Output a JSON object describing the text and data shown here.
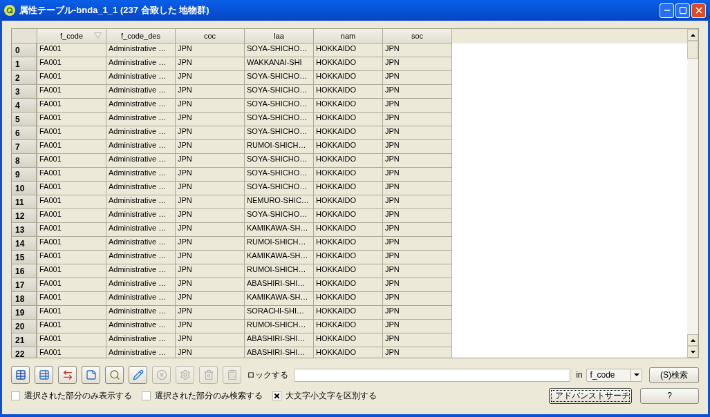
{
  "window": {
    "title": "属性テーブル-bnda_1_1 (237 合致した 地物群)"
  },
  "table": {
    "columns": [
      {
        "label": "f_code",
        "sorted": true
      },
      {
        "label": "f_code_des",
        "sorted": false
      },
      {
        "label": "coc",
        "sorted": false
      },
      {
        "label": "laa",
        "sorted": false
      },
      {
        "label": "nam",
        "sorted": false
      },
      {
        "label": "soc",
        "sorted": false
      }
    ],
    "rows": [
      {
        "header": "0",
        "cells": [
          "FA001",
          "Administrative …",
          "JPN",
          "SOYA-SHICHO…",
          "HOKKAIDO",
          "JPN"
        ]
      },
      {
        "header": "1",
        "cells": [
          "FA001",
          "Administrative …",
          "JPN",
          "WAKKANAI-SHI",
          "HOKKAIDO",
          "JPN"
        ]
      },
      {
        "header": "2",
        "cells": [
          "FA001",
          "Administrative …",
          "JPN",
          "SOYA-SHICHO…",
          "HOKKAIDO",
          "JPN"
        ]
      },
      {
        "header": "3",
        "cells": [
          "FA001",
          "Administrative …",
          "JPN",
          "SOYA-SHICHO…",
          "HOKKAIDO",
          "JPN"
        ]
      },
      {
        "header": "4",
        "cells": [
          "FA001",
          "Administrative …",
          "JPN",
          "SOYA-SHICHO…",
          "HOKKAIDO",
          "JPN"
        ]
      },
      {
        "header": "5",
        "cells": [
          "FA001",
          "Administrative …",
          "JPN",
          "SOYA-SHICHO…",
          "HOKKAIDO",
          "JPN"
        ]
      },
      {
        "header": "6",
        "cells": [
          "FA001",
          "Administrative …",
          "JPN",
          "SOYA-SHICHO…",
          "HOKKAIDO",
          "JPN"
        ]
      },
      {
        "header": "7",
        "cells": [
          "FA001",
          "Administrative …",
          "JPN",
          "RUMOI-SHICH…",
          "HOKKAIDO",
          "JPN"
        ]
      },
      {
        "header": "8",
        "cells": [
          "FA001",
          "Administrative …",
          "JPN",
          "SOYA-SHICHO…",
          "HOKKAIDO",
          "JPN"
        ]
      },
      {
        "header": "9",
        "cells": [
          "FA001",
          "Administrative …",
          "JPN",
          "SOYA-SHICHO…",
          "HOKKAIDO",
          "JPN"
        ]
      },
      {
        "header": "10",
        "cells": [
          "FA001",
          "Administrative …",
          "JPN",
          "SOYA-SHICHO…",
          "HOKKAIDO",
          "JPN"
        ]
      },
      {
        "header": "11",
        "cells": [
          "FA001",
          "Administrative …",
          "JPN",
          "NEMURO-SHIC…",
          "HOKKAIDO",
          "JPN"
        ]
      },
      {
        "header": "12",
        "cells": [
          "FA001",
          "Administrative …",
          "JPN",
          "SOYA-SHICHO…",
          "HOKKAIDO",
          "JPN"
        ]
      },
      {
        "header": "13",
        "cells": [
          "FA001",
          "Administrative …",
          "JPN",
          "KAMIKAWA-SH…",
          "HOKKAIDO",
          "JPN"
        ]
      },
      {
        "header": "14",
        "cells": [
          "FA001",
          "Administrative …",
          "JPN",
          "RUMOI-SHICH…",
          "HOKKAIDO",
          "JPN"
        ]
      },
      {
        "header": "15",
        "cells": [
          "FA001",
          "Administrative …",
          "JPN",
          "KAMIKAWA-SH…",
          "HOKKAIDO",
          "JPN"
        ]
      },
      {
        "header": "16",
        "cells": [
          "FA001",
          "Administrative …",
          "JPN",
          "RUMOI-SHICH…",
          "HOKKAIDO",
          "JPN"
        ]
      },
      {
        "header": "17",
        "cells": [
          "FA001",
          "Administrative …",
          "JPN",
          "ABASHIRI-SHI…",
          "HOKKAIDO",
          "JPN"
        ]
      },
      {
        "header": "18",
        "cells": [
          "FA001",
          "Administrative …",
          "JPN",
          "KAMIKAWA-SH…",
          "HOKKAIDO",
          "JPN"
        ]
      },
      {
        "header": "19",
        "cells": [
          "FA001",
          "Administrative …",
          "JPN",
          "SORACHI-SHI…",
          "HOKKAIDO",
          "JPN"
        ]
      },
      {
        "header": "20",
        "cells": [
          "FA001",
          "Administrative …",
          "JPN",
          "RUMOI-SHICH…",
          "HOKKAIDO",
          "JPN"
        ]
      },
      {
        "header": "21",
        "cells": [
          "FA001",
          "Administrative …",
          "JPN",
          "ABASHIRI-SHI…",
          "HOKKAIDO",
          "JPN"
        ]
      },
      {
        "header": "22",
        "cells": [
          "FA001",
          "Administrative …",
          "JPN",
          "ABASHIRI-SHI…",
          "HOKKAIDO",
          "JPN"
        ]
      }
    ]
  },
  "toolbar": [
    {
      "kind": "table",
      "disabled": false
    },
    {
      "kind": "table-up",
      "disabled": false
    },
    {
      "kind": "table-swap",
      "disabled": false
    },
    {
      "kind": "table-note",
      "disabled": false
    },
    {
      "kind": "zoom",
      "disabled": false
    },
    {
      "kind": "edit",
      "disabled": false
    },
    {
      "kind": "remove",
      "disabled": true
    },
    {
      "kind": "table-settings",
      "disabled": true
    },
    {
      "kind": "table-delete",
      "disabled": true
    },
    {
      "kind": "calculator",
      "disabled": true
    }
  ],
  "search": {
    "label": "ロックする",
    "in_label": "in",
    "field": "f_code",
    "button": "(S)検索"
  },
  "checkboxes": [
    {
      "label": "選択された部分のみ表示する",
      "checked": false
    },
    {
      "label": "選択された部分のみ検索する",
      "checked": false
    },
    {
      "label": "大文字小文字を区別する",
      "checked": true
    }
  ],
  "buttons": [
    "アドバンストサーチ",
    "?"
  ]
}
